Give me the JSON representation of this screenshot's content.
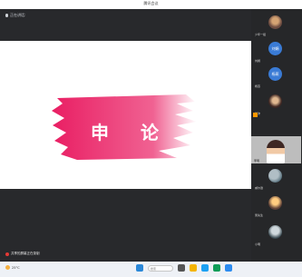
{
  "window": {
    "title": "腾讯会议"
  },
  "share": {
    "speaker": "正在讲话:"
  },
  "slide": {
    "title": "申 论"
  },
  "bottom_bar": {
    "label": "共享的屏幕正在录制"
  },
  "participants": [
    {
      "name": "少年一组",
      "avatar": "photo-a"
    },
    {
      "name": "刘娟",
      "avatar": "blue",
      "initials": "刘娟"
    },
    {
      "name": "杨燕",
      "avatar": "blue",
      "initials": "杨燕"
    },
    {
      "name": "楚沛",
      "avatar": "photo-b"
    },
    {
      "name": "李明",
      "avatar": "video"
    },
    {
      "name": "威尔逊",
      "avatar": "photo-c"
    },
    {
      "name": "吴先生",
      "avatar": "photo-d"
    },
    {
      "name": "小明",
      "avatar": "photo-e"
    }
  ],
  "taskbar": {
    "weather": "25°C",
    "search_placeholder": "搜索"
  },
  "colors": {
    "brand_pink": "#e91e63",
    "accent_blue": "#3a7bd5"
  }
}
